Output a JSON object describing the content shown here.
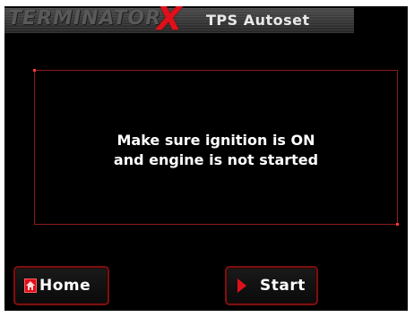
{
  "header": {
    "brand_text": "TERMINATOR",
    "brand_mark": "X",
    "title": "TPS Autoset"
  },
  "message": {
    "line1": "Make sure ignition is ON",
    "line2": "and engine is not started"
  },
  "buttons": {
    "home": {
      "label": "Home",
      "icon": "home-icon"
    },
    "start": {
      "label": "Start",
      "icon": "play-icon"
    }
  },
  "colors": {
    "accent": "#e0101a",
    "border": "#8c1a1a",
    "background": "#000000",
    "text": "#ffffff"
  }
}
